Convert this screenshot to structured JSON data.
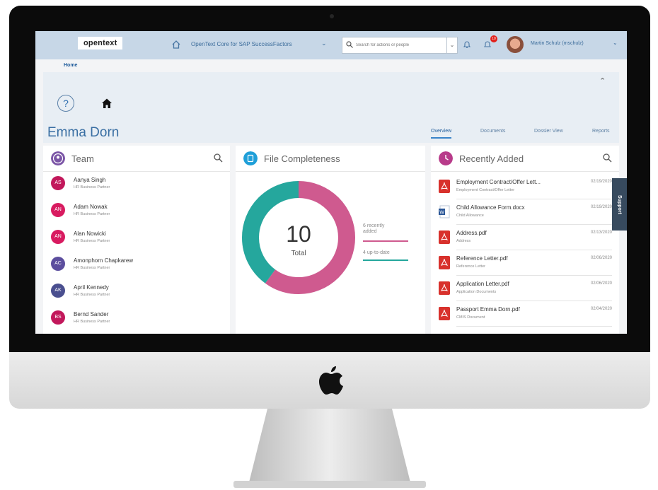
{
  "shell": {
    "logo": "opentext",
    "app_title": "OpenText Core for SAP SuccessFactors",
    "search_placeholder": "Search for actions or people",
    "notification_count": "10",
    "user_name": "Martin Schulz (mschulz)",
    "home_tab": "Home"
  },
  "header": {
    "person_name": "Emma Dorn",
    "tabs": [
      {
        "label": "Overview",
        "active": true
      },
      {
        "label": "Documents"
      },
      {
        "label": "Dossier View"
      },
      {
        "label": "Reports"
      }
    ]
  },
  "team": {
    "title": "Team",
    "members": [
      {
        "initials": "AS",
        "name": "Aanya Singh",
        "role": "HR Business Partner",
        "color": "#c2185b"
      },
      {
        "initials": "AN",
        "name": "Adam Nowak",
        "role": "HR Business Partner",
        "color": "#d81b60"
      },
      {
        "initials": "AN",
        "name": "Alan Nowicki",
        "role": "HR Business Partner",
        "color": "#d81b60"
      },
      {
        "initials": "AC",
        "name": "Amonphorn Chapkarew",
        "role": "HR Business Partner",
        "color": "#5c4e9e"
      },
      {
        "initials": "AK",
        "name": "April Kennedy",
        "role": "HR Business Partner",
        "color": "#4a4f8f"
      },
      {
        "initials": "BS",
        "name": "Bernd Sander",
        "role": "HR Business Partner",
        "color": "#c2185b"
      }
    ]
  },
  "completeness": {
    "title": "File Completeness",
    "total": "10",
    "total_label": "Total",
    "recently_added": 6,
    "up_to_date": 4,
    "recent_label": "6 recently added",
    "uptodate_label": "4 up-to-date",
    "colors": {
      "recent": "#cf5a8f",
      "uptodate": "#25a79d"
    }
  },
  "recent": {
    "title": "Recently Added",
    "support_label": "Support",
    "items": [
      {
        "name": "Employment Contract/Offer Lett...",
        "sub": "Employment Contract/Offer Letter",
        "date": "02/19/2020",
        "type": "pdf"
      },
      {
        "name": "Child Allowance Form.docx",
        "sub": "Child Allowance",
        "date": "02/19/2020",
        "type": "word"
      },
      {
        "name": "Address.pdf",
        "sub": "Address",
        "date": "02/13/2020",
        "type": "pdf"
      },
      {
        "name": "Reference Letter.pdf",
        "sub": "Reference Letter",
        "date": "02/06/2020",
        "type": "pdf"
      },
      {
        "name": "Application Letter.pdf",
        "sub": "Application Documents",
        "date": "02/06/2020",
        "type": "pdf"
      },
      {
        "name": "Passport Emma Dorn.pdf",
        "sub": "CMIS Document",
        "date": "02/04/2020",
        "type": "pdf"
      }
    ]
  },
  "colors": {
    "accent": "#3a6fa3",
    "shell": "#c7d7e7"
  }
}
